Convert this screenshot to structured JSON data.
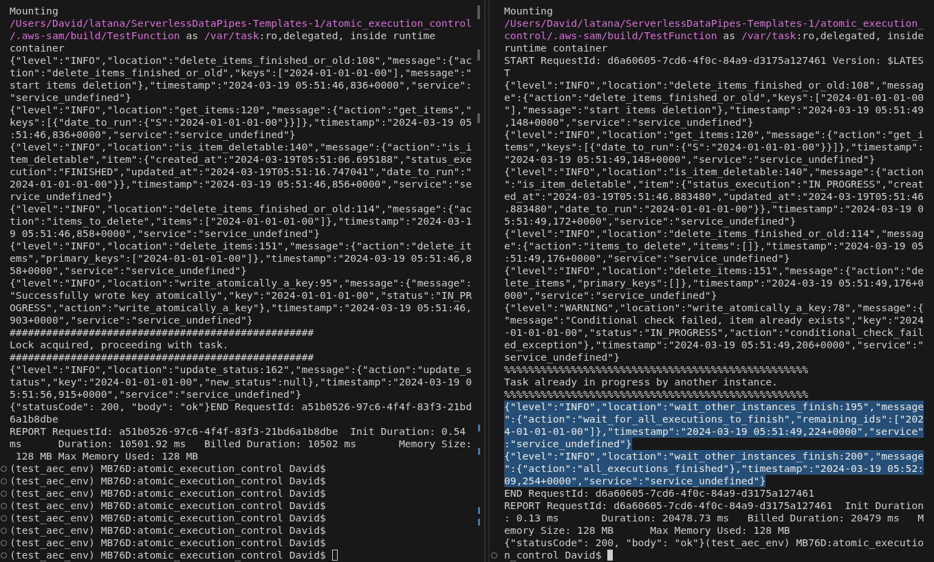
{
  "panes": [
    {
      "focused": false,
      "lines": [
        {
          "kind": "output",
          "selected": false,
          "text": "Mounting"
        },
        {
          "kind": "output",
          "selected": false,
          "parts": [
            {
              "kind": "path",
              "text": "/Users/David/latana/ServerlessDataPipes-Templates-1/atomic_execution_control"
            }
          ]
        },
        {
          "kind": "output",
          "selected": false,
          "parts": [
            {
              "kind": "path",
              "text": "/.aws-sam/build/TestFunction"
            },
            {
              "kind": "text",
              "text": " as "
            },
            {
              "kind": "path",
              "text": "/var/task"
            },
            {
              "kind": "text",
              "text": ":ro,delegated, inside runtime"
            }
          ]
        },
        {
          "kind": "output",
          "selected": false,
          "text": "container"
        },
        {
          "kind": "output",
          "selected": false,
          "text": "{\"level\":\"INFO\",\"location\":\"delete_items_finished_or_old:108\",\"message\":{\"ac"
        },
        {
          "kind": "output",
          "selected": false,
          "text": "tion\":\"delete_items_finished_or_old\",\"keys\":[\"2024-01-01-01-00\"],\"message\":\""
        },
        {
          "kind": "output",
          "selected": false,
          "text": "start items deletion\"},\"timestamp\":\"2024-03-19 05:51:46,836+0000\",\"service\":"
        },
        {
          "kind": "output",
          "selected": false,
          "text": "\"service_undefined\"}"
        },
        {
          "kind": "output",
          "selected": false,
          "text": "{\"level\":\"INFO\",\"location\":\"get_items:120\",\"message\":{\"action\":\"get_items\",\""
        },
        {
          "kind": "output",
          "selected": false,
          "text": "keys\":[{\"date_to_run\":{\"S\":\"2024-01-01-01-00\"}}]},\"timestamp\":\"2024-03-19 05"
        },
        {
          "kind": "output",
          "selected": false,
          "text": ":51:46,836+0000\",\"service\":\"service_undefined\"}"
        },
        {
          "kind": "output",
          "selected": false,
          "text": "{\"level\":\"INFO\",\"location\":\"is_item_deletable:140\",\"message\":{\"action\":\"is_i"
        },
        {
          "kind": "output",
          "selected": false,
          "text": "tem_deletable\",\"item\":{\"created_at\":\"2024-03-19T05:51:06.695188\",\"status_exe"
        },
        {
          "kind": "output",
          "selected": false,
          "text": "cution\":\"FINISHED\",\"updated_at\":\"2024-03-19T05:51:16.747041\",\"date_to_run\":\""
        },
        {
          "kind": "output",
          "selected": false,
          "text": "2024-01-01-01-00\"}},\"timestamp\":\"2024-03-19 05:51:46,856+0000\",\"service\":\"se"
        },
        {
          "kind": "output",
          "selected": false,
          "text": "rvice_undefined\"}"
        },
        {
          "kind": "output",
          "selected": false,
          "text": "{\"level\":\"INFO\",\"location\":\"delete_items_finished_or_old:114\",\"message\":{\"ac"
        },
        {
          "kind": "output",
          "selected": false,
          "text": "tion\":\"items_to_delete\",\"items\":[\"2024-01-01-01-00\"]},\"timestamp\":\"2024-03-1"
        },
        {
          "kind": "output",
          "selected": false,
          "text": "9 05:51:46,858+0000\",\"service\":\"service_undefined\"}"
        },
        {
          "kind": "output",
          "selected": false,
          "text": "{\"level\":\"INFO\",\"location\":\"delete_items:151\",\"message\":{\"action\":\"delete_it"
        },
        {
          "kind": "output",
          "selected": false,
          "text": "ems\",\"primary_keys\":[\"2024-01-01-01-00\"]},\"timestamp\":\"2024-03-19 05:51:46,8"
        },
        {
          "kind": "output",
          "selected": false,
          "text": "58+0000\",\"service\":\"service_undefined\"}"
        },
        {
          "kind": "output",
          "selected": false,
          "text": "{\"level\":\"INFO\",\"location\":\"write_atomically_a_key:95\",\"message\":{\"message\":"
        },
        {
          "kind": "output",
          "selected": false,
          "text": "\"Successfully wrote key atomically\",\"key\":\"2024-01-01-01-00\",\"status\":\"IN_PR"
        },
        {
          "kind": "output",
          "selected": false,
          "text": "OGRESS\",\"action\":\"write_atomically_a_key\"},\"timestamp\":\"2024-03-19 05:51:46,"
        },
        {
          "kind": "output",
          "selected": false,
          "text": "903+0000\",\"service\":\"service_undefined\"}"
        },
        {
          "kind": "output",
          "selected": false,
          "text": "##################################################"
        },
        {
          "kind": "output",
          "selected": false,
          "text": "Lock acquired, proceeding with task."
        },
        {
          "kind": "output",
          "selected": false,
          "text": "##################################################"
        },
        {
          "kind": "output",
          "selected": false,
          "text": "{\"level\":\"INFO\",\"location\":\"update_status:162\",\"message\":{\"action\":\"update_s"
        },
        {
          "kind": "output",
          "selected": false,
          "text": "tatus\",\"key\":\"2024-01-01-01-00\",\"new_status\":null},\"timestamp\":\"2024-03-19 0"
        },
        {
          "kind": "output",
          "selected": false,
          "text": "5:51:56,915+0000\",\"service\":\"service_undefined\"}"
        },
        {
          "kind": "output",
          "selected": false,
          "text": "{\"statusCode\": 200, \"body\": \"ok\"}END RequestId: a51b0526-97c6-4f4f-83f3-21bd"
        },
        {
          "kind": "output",
          "selected": false,
          "text": "6a1b8dbe"
        },
        {
          "kind": "output",
          "selected": false,
          "text": "REPORT RequestId: a51b0526-97c6-4f4f-83f3-21bd6a1b8dbe  Init Duration: 0.54"
        },
        {
          "kind": "output",
          "selected": false,
          "text": "ms      Duration: 10501.92 ms   Billed Duration: 10502 ms       Memory Size:"
        },
        {
          "kind": "output",
          "selected": false,
          "text": " 128 MB Max Memory Used: 128 MB"
        },
        {
          "kind": "prompt",
          "selected": false,
          "text": "(test_aec_env) MB76D:atomic_execution_control David$"
        },
        {
          "kind": "prompt",
          "selected": false,
          "text": "(test_aec_env) MB76D:atomic_execution_control David$"
        },
        {
          "kind": "prompt",
          "selected": false,
          "text": "(test_aec_env) MB76D:atomic_execution_control David$"
        },
        {
          "kind": "prompt",
          "selected": false,
          "text": "(test_aec_env) MB76D:atomic_execution_control David$"
        },
        {
          "kind": "prompt",
          "selected": false,
          "text": "(test_aec_env) MB76D:atomic_execution_control David$"
        },
        {
          "kind": "prompt",
          "selected": false,
          "text": "(test_aec_env) MB76D:atomic_execution_control David$"
        },
        {
          "kind": "prompt",
          "selected": false,
          "text": "(test_aec_env) MB76D:atomic_execution_control David$"
        },
        {
          "kind": "prompt",
          "selected": false,
          "text": "(test_aec_env) MB76D:atomic_execution_control David$"
        }
      ]
    },
    {
      "focused": true,
      "lines": [
        {
          "kind": "output",
          "selected": false,
          "text": "Mounting"
        },
        {
          "kind": "output",
          "selected": false,
          "parts": [
            {
              "kind": "path",
              "text": "/Users/David/latana/ServerlessDataPipes-Templates-1/atomic_execution_"
            }
          ]
        },
        {
          "kind": "output",
          "selected": false,
          "parts": [
            {
              "kind": "path",
              "text": "control/.aws-sam/build/TestFunction"
            },
            {
              "kind": "text",
              "text": " as "
            },
            {
              "kind": "path",
              "text": "/var/task"
            },
            {
              "kind": "text",
              "text": ":ro,delegated, inside"
            }
          ]
        },
        {
          "kind": "output",
          "selected": false,
          "text": "runtime container"
        },
        {
          "kind": "output",
          "selected": false,
          "text": "START RequestId: d6a60605-7cd6-4f0c-84a9-d3175a127461 Version: $LATES"
        },
        {
          "kind": "output",
          "selected": false,
          "text": "T"
        },
        {
          "kind": "output",
          "selected": false,
          "text": "{\"level\":\"INFO\",\"location\":\"delete_items_finished_or_old:108\",\"messag"
        },
        {
          "kind": "output",
          "selected": false,
          "text": "e\":{\"action\":\"delete_items_finished_or_old\",\"keys\":[\"2024-01-01-01-00"
        },
        {
          "kind": "output",
          "selected": false,
          "text": "\"],\"message\":\"start items deletion\"},\"timestamp\":\"2024-03-19 05:51:49"
        },
        {
          "kind": "output",
          "selected": false,
          "text": ",148+0000\",\"service\":\"service_undefined\"}"
        },
        {
          "kind": "output",
          "selected": false,
          "text": "{\"level\":\"INFO\",\"location\":\"get_items:120\",\"message\":{\"action\":\"get_i"
        },
        {
          "kind": "output",
          "selected": false,
          "text": "tems\",\"keys\":[{\"date_to_run\":{\"S\":\"2024-01-01-01-00\"}}]},\"timestamp\":"
        },
        {
          "kind": "output",
          "selected": false,
          "text": "\"2024-03-19 05:51:49,148+0000\",\"service\":\"service_undefined\"}"
        },
        {
          "kind": "output",
          "selected": false,
          "text": "{\"level\":\"INFO\",\"location\":\"is_item_deletable:140\",\"message\":{\"action"
        },
        {
          "kind": "output",
          "selected": false,
          "text": "\":\"is_item_deletable\",\"item\":{\"status_execution\":\"IN_PROGRESS\",\"creat"
        },
        {
          "kind": "output",
          "selected": false,
          "text": "ed_at\":\"2024-03-19T05:51:46.883480\",\"updated_at\":\"2024-03-19T05:51:46"
        },
        {
          "kind": "output",
          "selected": false,
          "text": ".883480\",\"date_to_run\":\"2024-01-01-01-00\"}},\"timestamp\":\"2024-03-19 0"
        },
        {
          "kind": "output",
          "selected": false,
          "text": "5:51:49,172+0000\",\"service\":\"service_undefined\"}"
        },
        {
          "kind": "output",
          "selected": false,
          "text": "{\"level\":\"INFO\",\"location\":\"delete_items_finished_or_old:114\",\"messag"
        },
        {
          "kind": "output",
          "selected": false,
          "text": "e\":{\"action\":\"items_to_delete\",\"items\":[]},\"timestamp\":\"2024-03-19 05"
        },
        {
          "kind": "output",
          "selected": false,
          "text": ":51:49,176+0000\",\"service\":\"service_undefined\"}"
        },
        {
          "kind": "output",
          "selected": false,
          "text": "{\"level\":\"INFO\",\"location\":\"delete_items:151\",\"message\":{\"action\":\"de"
        },
        {
          "kind": "output",
          "selected": false,
          "text": "lete_items\",\"primary_keys\":[]},\"timestamp\":\"2024-03-19 05:51:49,176+0"
        },
        {
          "kind": "output",
          "selected": false,
          "text": "000\",\"service\":\"service_undefined\"}"
        },
        {
          "kind": "output",
          "selected": false,
          "text": "{\"level\":\"WARNING\",\"location\":\"write_atomically_a_key:78\",\"message\":{"
        },
        {
          "kind": "output",
          "selected": false,
          "text": "\"message\":\"Conditional check failed, item already exists\",\"key\":\"2024"
        },
        {
          "kind": "output",
          "selected": false,
          "text": "-01-01-01-00\",\"status\":\"IN_PROGRESS\",\"action\":\"conditional_check_fail"
        },
        {
          "kind": "output",
          "selected": false,
          "text": "ed_exception\"},\"timestamp\":\"2024-03-19 05:51:49,206+0000\",\"service\":\""
        },
        {
          "kind": "output",
          "selected": false,
          "text": "service_undefined\"}"
        },
        {
          "kind": "output",
          "selected": false,
          "text": "%%%%%%%%%%%%%%%%%%%%%%%%%%%%%%%%%%%%%%%%%%%%%%%%%%"
        },
        {
          "kind": "output",
          "selected": false,
          "text": "Task already in progress by another instance."
        },
        {
          "kind": "output",
          "selected": false,
          "text": "%%%%%%%%%%%%%%%%%%%%%%%%%%%%%%%%%%%%%%%%%%%%%%%%%%"
        },
        {
          "kind": "output",
          "selected": true,
          "text": "{\"level\":\"INFO\",\"location\":\"wait_other_instances_finish:195\",\"message"
        },
        {
          "kind": "output",
          "selected": true,
          "text": "\":{\"action\":\"wait_for_all_executions_to_finish\",\"remaining_ids\":[\"202"
        },
        {
          "kind": "output",
          "selected": true,
          "text": "4-01-01-01-00\"]},\"timestamp\":\"2024-03-19 05:51:49,224+0000\",\"service\""
        },
        {
          "kind": "output",
          "selected": true,
          "text": ":\"service_undefined\"}"
        },
        {
          "kind": "output",
          "selected": true,
          "text": "{\"level\":\"INFO\",\"location\":\"wait_other_instances_finish:200\",\"message"
        },
        {
          "kind": "output",
          "selected": true,
          "text": "\":{\"action\":\"all_executions_finished\"},\"timestamp\":\"2024-03-19 05:52:"
        },
        {
          "kind": "output",
          "selected": true,
          "text": "09,254+0000\",\"service\":\"service_undefined\"}"
        },
        {
          "kind": "output",
          "selected": false,
          "text": "END RequestId: d6a60605-7cd6-4f0c-84a9-d3175a127461"
        },
        {
          "kind": "output",
          "selected": false,
          "text": "REPORT RequestId: d6a60605-7cd6-4f0c-84a9-d3175a127461  Init Duration"
        },
        {
          "kind": "output",
          "selected": false,
          "text": ": 0.13 ms       Duration: 20478.73 ms   Billed Duration: 20479 ms   M"
        },
        {
          "kind": "output",
          "selected": false,
          "text": "emory Size: 128 MB      Max Memory Used: 128 MB"
        },
        {
          "kind": "output",
          "selected": false,
          "text": "{\"statusCode\": 200, \"body\": \"ok\"}(test_aec_env) MB76D:atomic_executio"
        },
        {
          "kind": "prompt",
          "selected": false,
          "text": "n_control David$"
        }
      ]
    }
  ]
}
